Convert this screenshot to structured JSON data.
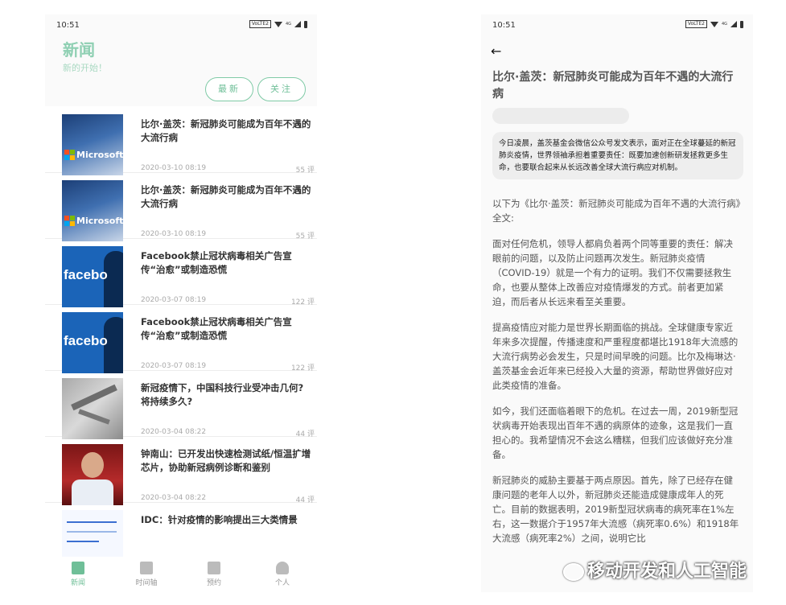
{
  "left": {
    "status": {
      "time": "10:51",
      "volte": "VoLTE2",
      "net": "4G"
    },
    "header": {
      "title": "新闻",
      "subtitle": "新的开始！"
    },
    "filters": {
      "latest": "最新",
      "follow": "关注"
    },
    "news": [
      {
        "title": "比尔·盖茨：新冠肺炎可能成为百年不遇的大流行病",
        "date": "2020-03-10 08:19",
        "comments": "55 评",
        "thumb": "microsoft"
      },
      {
        "title": "比尔·盖茨：新冠肺炎可能成为百年不遇的大流行病",
        "date": "2020-03-10 08:19",
        "comments": "55 评",
        "thumb": "microsoft"
      },
      {
        "title": "Facebook禁止冠状病毒相关广告宣传“治愈”或制造恐慌",
        "date": "2020-03-07 08:19",
        "comments": "122 评",
        "thumb": "facebook"
      },
      {
        "title": "Facebook禁止冠状病毒相关广告宣传“治愈”或制造恐慌",
        "date": "2020-03-07 08:19",
        "comments": "122 评",
        "thumb": "facebook"
      },
      {
        "title": "新冠疫情下，中国科技行业受冲击几何?将持续多久?",
        "date": "2020-03-04 08:22",
        "comments": "44 评",
        "thumb": "lab"
      },
      {
        "title": "钟南山：已开发出快速检测试纸/恒温扩增芯片，协助新冠病例诊断和鉴别",
        "date": "2020-03-04 08:22",
        "comments": "44 评",
        "thumb": "person"
      },
      {
        "title": "IDC：针对疫情的影响提出三大类情景",
        "date": "",
        "comments": "",
        "thumb": "chart"
      }
    ],
    "thumbs": {
      "microsoft": "Microsoft",
      "facebook": "facebo"
    },
    "nav": {
      "news": "新闻",
      "timeline": "时间轴",
      "booking": "预约",
      "me": "个人"
    },
    "colors": {
      "accent": "#6fbf98"
    }
  },
  "right": {
    "status": {
      "time": "10:51",
      "volte": "VoLTE2",
      "net": "4G"
    },
    "title": "比尔·盖茨：新冠肺炎可能成为百年不遇的大流行病",
    "summary": "今日凌晨，盖茨基金会微信公众号发文表示，面对正在全球蔓延的新冠肺炎疫情，世界领袖承担着重要责任：既要加速创新研发拯救更多生命，也要联合起来从长远改善全球大流行病应对机制。",
    "paragraphs": [
      "以下为《比尔·盖茨：新冠肺炎可能成为百年不遇的大流行病》全文:",
      "面对任何危机，领导人都肩负着两个同等重要的责任：解决眼前的问题，以及防止问题再次发生。新冠肺炎疫情（COVID-19）就是一个有力的证明。我们不仅需要拯救生命，也要从整体上改善应对疫情爆发的方式。前者更加紧迫，而后者从长远来看至关重要。",
      "提高疫情应对能力是世界长期面临的挑战。全球健康专家近年来多次提醒，传播速度和严重程度都堪比1918年大流感的大流行病势必会发生，只是时间早晚的问题。比尔及梅琳达·盖茨基金会近年来已经投入大量的资源，帮助世界做好应对此类疫情的准备。",
      "如今，我们还面临着眼下的危机。在过去一周，2019新型冠状病毒开始表现出百年不遇的病原体的迹象，这是我们一直担心的。我希望情况不会这么糟糕，但我们应该做好充分准备。",
      "新冠肺炎的威胁主要基于两点原因。首先，除了已经存在健康问题的老年人以外，新冠肺炎还能造成健康成年人的死亡。目前的数据表明，2019新型冠状病毒的病死率在1%左右，这一数据介于1957年大流感（病死率0.6%）和1918年大流感（病死率2%）之间，说明它比"
    ],
    "watermark": "移动开发和人工智能"
  }
}
